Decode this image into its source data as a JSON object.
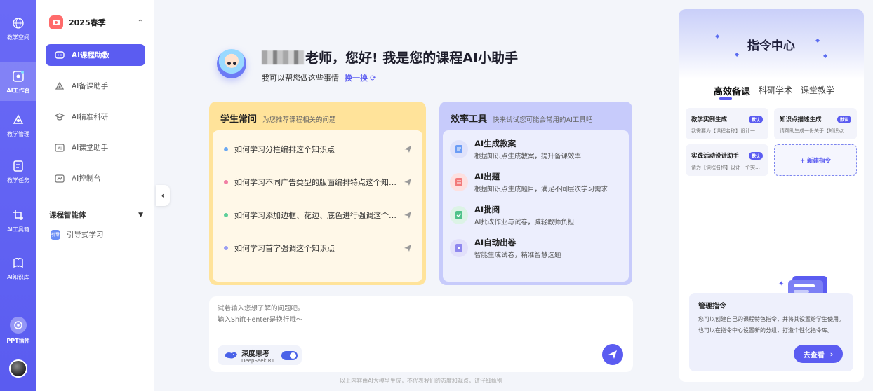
{
  "rail": {
    "items": [
      {
        "label": "教学空间",
        "icon": "globe-icon"
      },
      {
        "label": "AI工作台",
        "icon": "ai-workbench-icon"
      },
      {
        "label": "教学管理",
        "icon": "manage-icon"
      },
      {
        "label": "教学任务",
        "icon": "task-icon"
      },
      {
        "label": "AI工具箱",
        "icon": "toolbox-icon"
      },
      {
        "label": "AI知识库",
        "icon": "knowledge-icon"
      }
    ],
    "ppt_label": "PPT插件"
  },
  "sidebar": {
    "season": "2025春季",
    "items": [
      {
        "label": "AI课程助教"
      },
      {
        "label": "AI备课助手"
      },
      {
        "label": "AI精准科研"
      },
      {
        "label": "AI课堂助手"
      },
      {
        "label": "AI控制台"
      }
    ],
    "group_label": "课程智能体",
    "sub_item": "引导式学习",
    "sub_badge": "引导"
  },
  "greeting": {
    "title_suffix": "老师，您好! 我是您的课程AI小助手",
    "subtitle": "我可以帮您做这些事情",
    "swap": "换一换"
  },
  "faq": {
    "title": "学生常问",
    "desc": "为您推荐课程相关的问题",
    "questions": [
      {
        "text": "如何学习分栏编排这个知识点",
        "color": "#6aa8f2"
      },
      {
        "text": "如何学习不同广告类型的版面编排特点这个知识点",
        "color": "#f17fa5"
      },
      {
        "text": "如何学习添加边框、花边、底色进行强调这个知识点",
        "color": "#5ecf9a"
      },
      {
        "text": "如何学习首字强调这个知识点",
        "color": "#9a9ef2"
      }
    ]
  },
  "tools": {
    "title": "效率工具",
    "desc": "快来试试您可能会常用的AI工具吧",
    "items": [
      {
        "title": "AI生成教案",
        "desc": "根据知识点生成教案，提升备课效率"
      },
      {
        "title": "AI出题",
        "desc": "根据知识点生成题目，满足不同层次学习需求"
      },
      {
        "title": "AI批阅",
        "desc": "AI批改作业与试卷，减轻教师负担"
      },
      {
        "title": "AI自动出卷",
        "desc": "智能生成试卷，精准智慧选题"
      }
    ]
  },
  "input": {
    "placeholder": "试着输入您想了解的问题吧。\n输入Shift+enter是换行哦～",
    "deep_title": "深度思考",
    "deep_sub": "DeepSeek R1"
  },
  "disclaimer": "以上内容由AI大模型生成，不代表我们的态度和观点，请仔细甄别",
  "panel": {
    "title": "指令中心",
    "tabs": [
      "高效备课",
      "科研学术",
      "课堂教学"
    ],
    "commands": [
      {
        "title": "教学实例生成",
        "badge": "默认",
        "desc": "我需要为【课程名称】设计一个教学实例"
      },
      {
        "title": "知识点描述生成",
        "badge": "默认",
        "desc": "请帮助生成一份关于【知识点】的描述"
      },
      {
        "title": "实践活动设计助手",
        "badge": "默认",
        "desc": "请为【课程名称】设计一个实践活动"
      }
    ],
    "new_command": "+ 新建指令",
    "manage_title": "管理指令",
    "manage_desc": "您可以创建自己的课程特色指令，并将其设置给学生使用。也可以在指令中心设置新的分组，打造个性化指令库。",
    "manage_button": "去查看",
    "manage_arrow": "›"
  }
}
